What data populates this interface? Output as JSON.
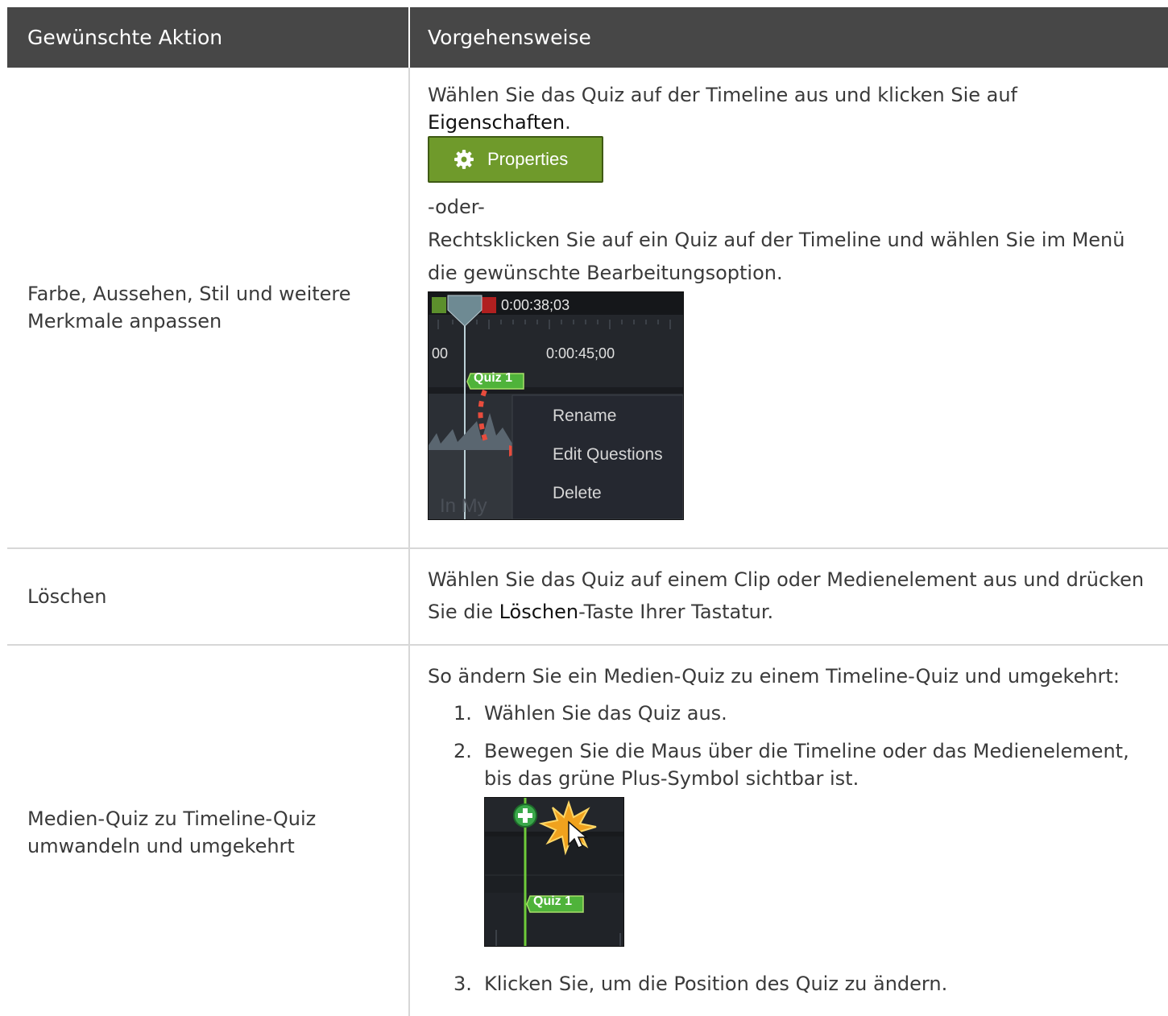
{
  "table": {
    "header": {
      "col_action": "Gewünschte Aktion",
      "col_procedure": "Vorgehensweise"
    },
    "rows": [
      {
        "action": "Farbe, Aussehen, Stil und weitere Merkmale anpassen",
        "line1": "Wählen Sie das Quiz auf der Timeline aus und klicken Sie auf",
        "line2_bold": "Eigenschaften",
        "line2_rest": ".",
        "button_label": "Properties",
        "or_text": "-oder-",
        "line3": "Rechtsklicken Sie auf ein Quiz auf der Timeline und wählen Sie im Menü die gewünschte Bearbeitungsoption.",
        "screenshot": {
          "timecode_top": "0:00:38;03",
          "tick_left": "00",
          "tick_right": "0:00:45;00",
          "quiz_label": "Quiz 1",
          "menu": [
            "Rename",
            "Edit Questions",
            "Delete"
          ],
          "bg_text": "In My"
        }
      },
      {
        "action": "Löschen",
        "line1": "Wählen Sie das Quiz auf einem Clip oder Medienelement aus und drücken",
        "line2_pre": "Sie die ",
        "line2_bold": "Löschen",
        "line2_rest": "-Taste Ihrer Tastatur."
      },
      {
        "action": "Medien-Quiz zu Timeline-Quiz umwandeln und umgekehrt",
        "intro": "So ändern Sie ein Medien-Quiz zu einem Timeline-Quiz und umgekehrt:",
        "steps": [
          {
            "num": "1.",
            "text": "Wählen Sie das Quiz aus."
          },
          {
            "num": "2.",
            "text": "Bewegen Sie die Maus über die Timeline oder das Medienelement, bis das grüne Plus-Symbol sichtbar ist."
          },
          {
            "num": "3.",
            "text": "Klicken Sie, um die Position des Quiz zu ändern."
          }
        ],
        "screenshot_quiz_label": "Quiz 1"
      }
    ]
  },
  "colors": {
    "header_bg": "#474747",
    "properties_button": "#6f9a2b",
    "quiz_green": "#4fb33a",
    "arrow_red": "#e84c3d"
  }
}
